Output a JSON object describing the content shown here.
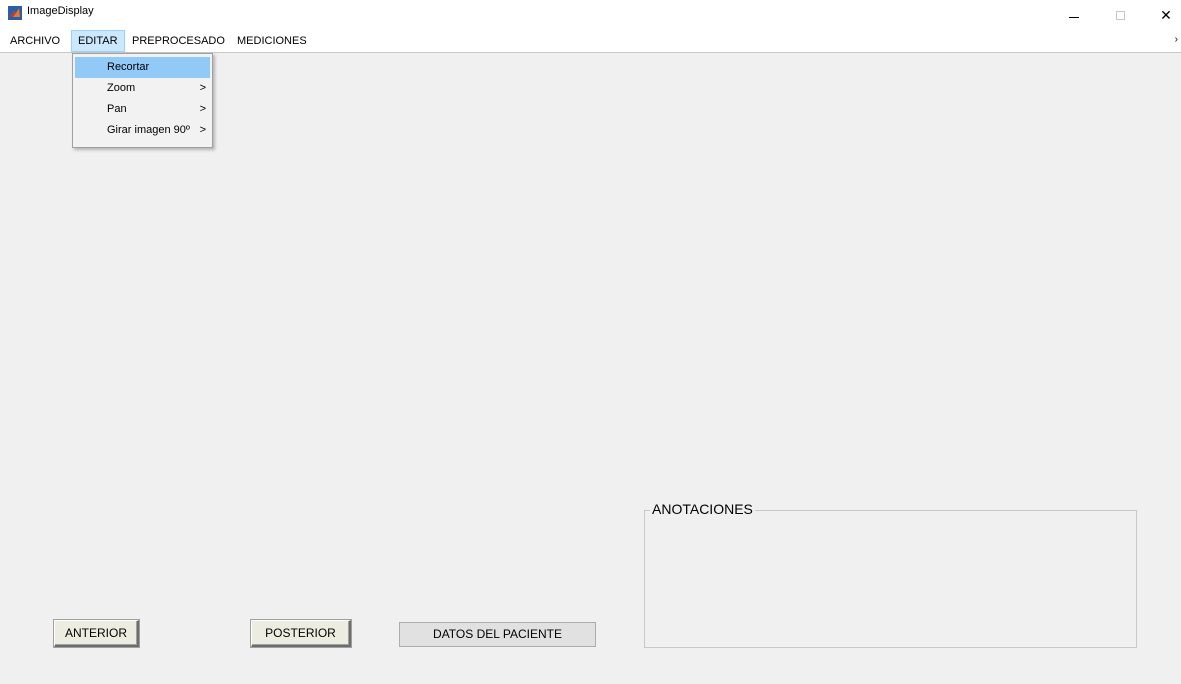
{
  "window": {
    "title": "ImageDisplay",
    "minimize_glyph": "—",
    "close_glyph": "✕"
  },
  "menubar": {
    "items": [
      {
        "label": "ARCHIVO"
      },
      {
        "label": "EDITAR"
      },
      {
        "label": "PREPROCESADO"
      },
      {
        "label": "MEDICIONES"
      }
    ],
    "edge_glyph": "›"
  },
  "dropdown": {
    "items": [
      {
        "label": "Recortar",
        "arrow": ""
      },
      {
        "label": "Zoom",
        "arrow": ">"
      },
      {
        "label": "Pan",
        "arrow": ">"
      },
      {
        "label": "Girar imagen 90º",
        "arrow": ">"
      }
    ]
  },
  "buttons": {
    "anterior": "ANTERIOR",
    "posterior": "POSTERIOR",
    "datos_paciente": "DATOS DEL PACIENTE"
  },
  "panel": {
    "title": "ANOTACIONES"
  },
  "colors": {
    "accent_highlight": "#91c9f7",
    "menu_active": "#cce8ff",
    "background": "#f0f0f0"
  }
}
